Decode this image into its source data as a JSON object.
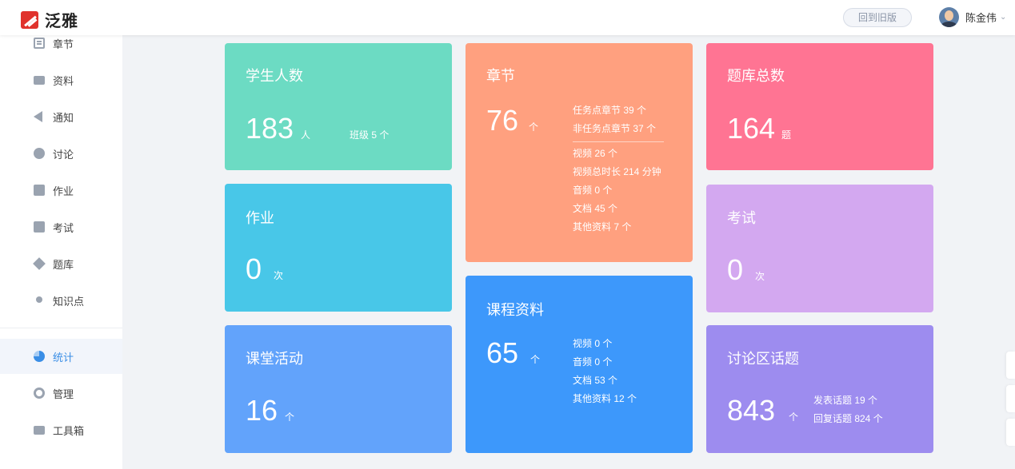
{
  "header": {
    "logo_text": "泛雅",
    "old_version_button": "回到旧版",
    "user_name": "陈金伟"
  },
  "sidebar": {
    "items": [
      {
        "label": "章节",
        "icon": "chapter-icon"
      },
      {
        "label": "资料",
        "icon": "folder-icon"
      },
      {
        "label": "通知",
        "icon": "speaker-icon"
      },
      {
        "label": "讨论",
        "icon": "chat-icon"
      },
      {
        "label": "作业",
        "icon": "homework-icon"
      },
      {
        "label": "考试",
        "icon": "exam-icon"
      },
      {
        "label": "题库",
        "icon": "layers-icon"
      },
      {
        "label": "知识点",
        "icon": "knowledge-icon"
      },
      {
        "label": "统计",
        "icon": "pie-chart-icon",
        "active": true
      },
      {
        "label": "管理",
        "icon": "gear-icon"
      },
      {
        "label": "工具箱",
        "icon": "toolbox-icon"
      }
    ]
  },
  "cards": {
    "students": {
      "title": "学生人数",
      "value": "183",
      "unit": "人",
      "extra": "班级 5 个",
      "color": "#6cdbc3"
    },
    "homework": {
      "title": "作业",
      "value": "0",
      "unit": "次",
      "color": "#48c7e8"
    },
    "activities": {
      "title": "课堂活动",
      "value": "16",
      "unit": "个",
      "color": "#62a3fb"
    },
    "chapters": {
      "title": "章节",
      "value": "76",
      "unit": "个",
      "details": [
        "任务点章节 39 个",
        "非任务点章节 37 个"
      ],
      "details2": [
        "视频 26 个",
        "视频总时长 214 分钟",
        "音频 0 个",
        "文档 45 个",
        "其他资料 7 个"
      ],
      "color": "#ffa07f"
    },
    "resources": {
      "title": "课程资料",
      "value": "65",
      "unit": "个",
      "details": [
        "视频 0 个",
        "音频 0 个",
        "文档 53 个",
        "其他资料 12 个"
      ],
      "color": "#3d98fb"
    },
    "question_bank": {
      "title": "题库总数",
      "value": "164",
      "unit": "题",
      "color": "#ff7493"
    },
    "exams": {
      "title": "考试",
      "value": "0",
      "unit": "次",
      "color": "#d3a8f0"
    },
    "topics": {
      "title": "讨论区话题",
      "value": "843",
      "unit": "个",
      "details": [
        "发表话题 19 个",
        "回复话题 824 个"
      ],
      "color": "#9d8cef"
    }
  }
}
